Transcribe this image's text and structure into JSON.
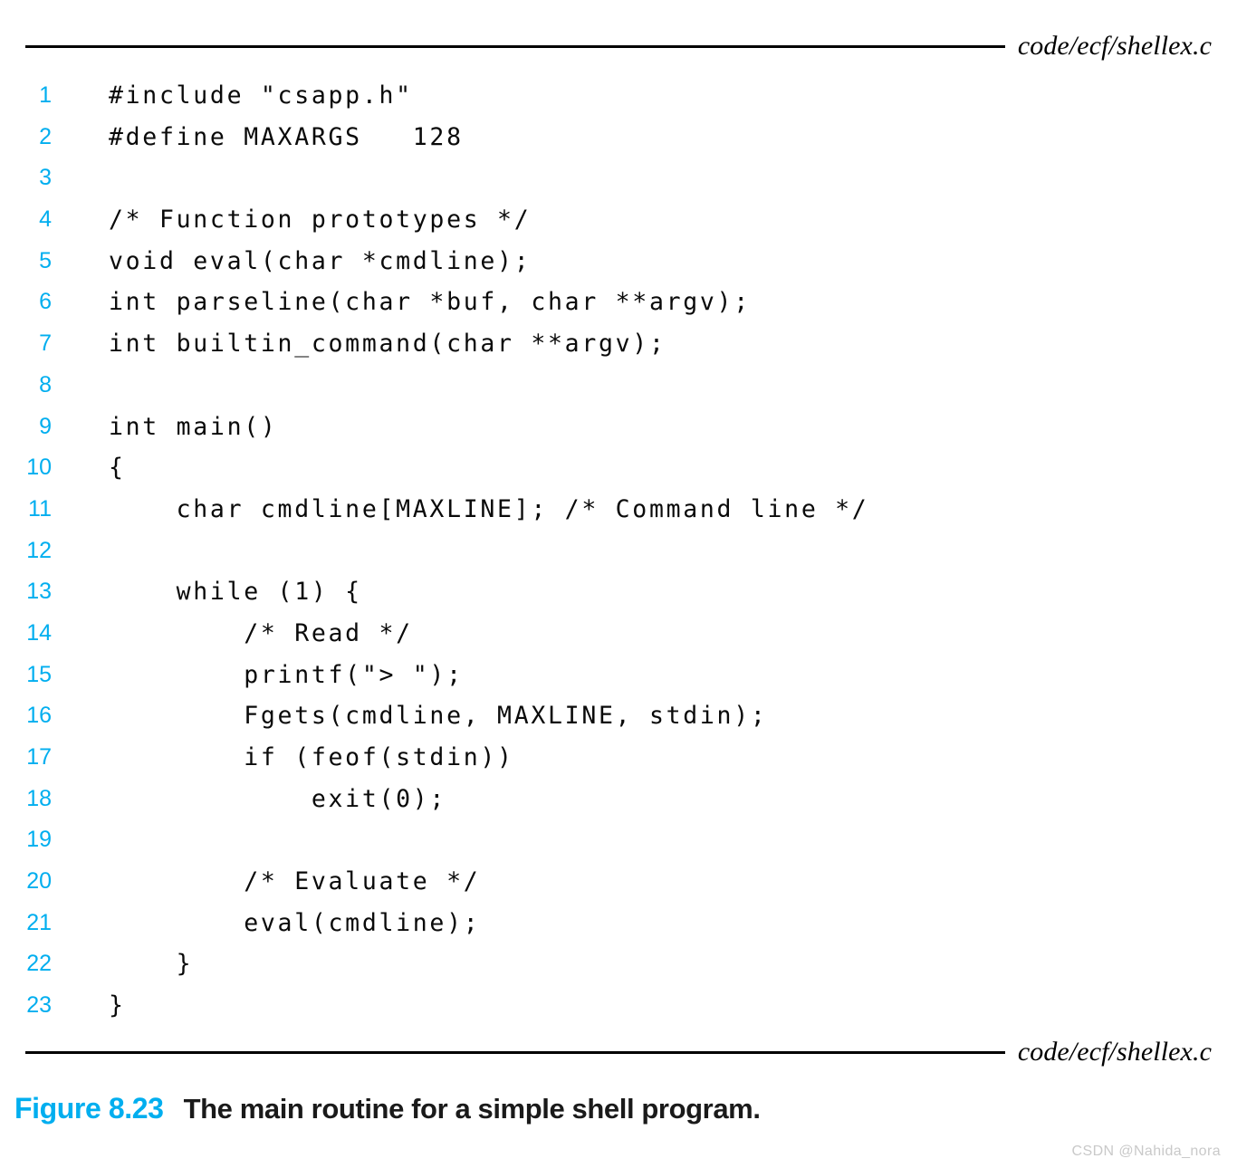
{
  "figure": {
    "file_label_top": "code/ecf/shellex.c",
    "file_label_bottom": "code/ecf/shellex.c",
    "accent_color": "#00AEEF",
    "rule_color": "#000000",
    "code_color": "#0A0A0A",
    "background": "#FFFFFF"
  },
  "code": {
    "language": "c",
    "first_line_number": 1,
    "last_line_number": 23,
    "lines": [
      {
        "n": "1",
        "text": "#include \"csapp.h\""
      },
      {
        "n": "2",
        "text": "#define MAXARGS   128"
      },
      {
        "n": "3",
        "text": ""
      },
      {
        "n": "4",
        "text": "/* Function prototypes */"
      },
      {
        "n": "5",
        "text": "void eval(char *cmdline);"
      },
      {
        "n": "6",
        "text": "int parseline(char *buf, char **argv);"
      },
      {
        "n": "7",
        "text": "int builtin_command(char **argv);"
      },
      {
        "n": "8",
        "text": ""
      },
      {
        "n": "9",
        "text": "int main()"
      },
      {
        "n": "10",
        "text": "{"
      },
      {
        "n": "11",
        "text": "    char cmdline[MAXLINE]; /* Command line */"
      },
      {
        "n": "12",
        "text": ""
      },
      {
        "n": "13",
        "text": "    while (1) {"
      },
      {
        "n": "14",
        "text": "        /* Read */"
      },
      {
        "n": "15",
        "text": "        printf(\"> \");"
      },
      {
        "n": "16",
        "text": "        Fgets(cmdline, MAXLINE, stdin);"
      },
      {
        "n": "17",
        "text": "        if (feof(stdin))"
      },
      {
        "n": "18",
        "text": "            exit(0);"
      },
      {
        "n": "19",
        "text": ""
      },
      {
        "n": "20",
        "text": "        /* Evaluate */"
      },
      {
        "n": "21",
        "text": "        eval(cmdline);"
      },
      {
        "n": "22",
        "text": "    }"
      },
      {
        "n": "23",
        "text": "}"
      }
    ]
  },
  "caption": {
    "figure_number": "Figure 8.23",
    "title": "The main routine for a simple shell program."
  },
  "watermark": {
    "text": "CSDN @Nahida_nora"
  }
}
